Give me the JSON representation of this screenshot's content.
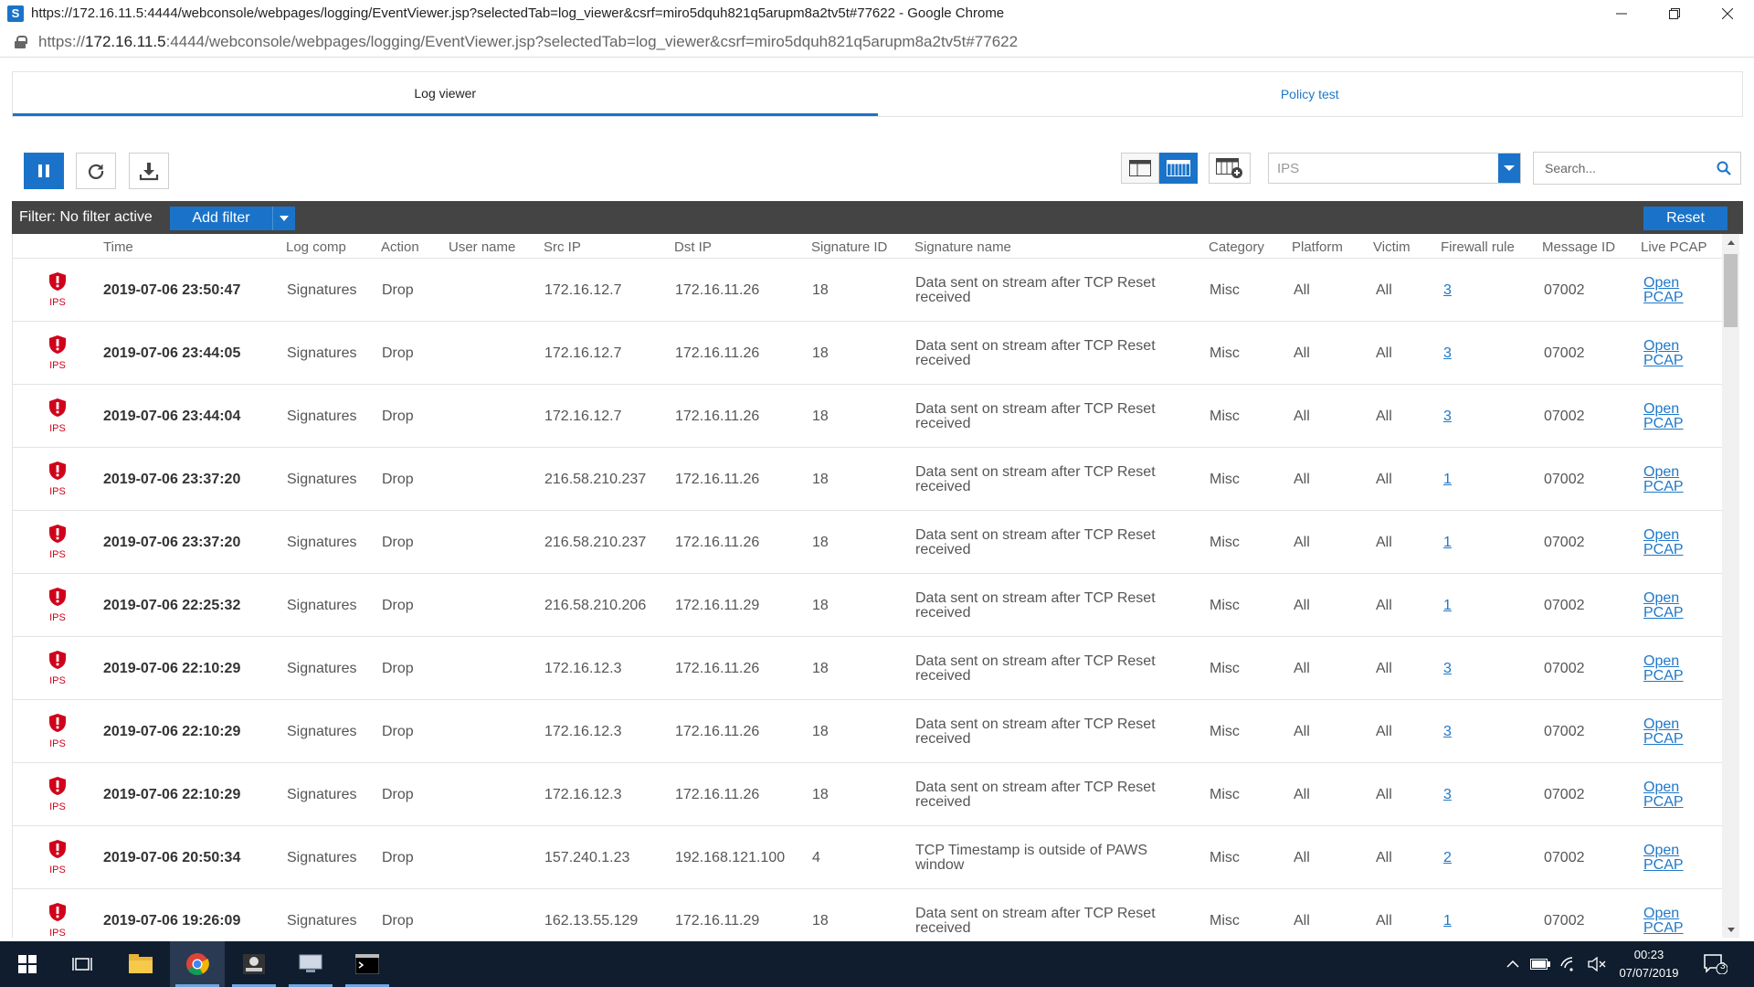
{
  "window": {
    "title": "https://172.16.11.5:4444/webconsole/webpages/logging/EventViewer.jsp?selectedTab=log_viewer&csrf=miro5dquh821q5arupm8a2tv5t#77622 - Google Chrome",
    "app_icon_letter": "S"
  },
  "address_bar": {
    "scheme": "https://",
    "host": "172.16.11.5",
    "rest": ":4444/webconsole/webpages/logging/EventViewer.jsp?selectedTab=log_viewer&csrf=miro5dquh821q5arupm8a2tv5t#77622"
  },
  "tabs": [
    {
      "label": "Log viewer",
      "active": true
    },
    {
      "label": "Policy test",
      "active": false
    }
  ],
  "toolbar": {
    "module_select_value": "IPS",
    "search_placeholder": "Search..."
  },
  "filter_bar": {
    "label": "Filter: No filter active",
    "add_filter_label": "Add filter",
    "reset_label": "Reset"
  },
  "table": {
    "columns": [
      "Time",
      "Log comp",
      "Action",
      "User name",
      "Src IP",
      "Dst IP",
      "Signature ID",
      "Signature name",
      "Category",
      "Platform",
      "Victim",
      "Firewall rule",
      "Message ID",
      "Live PCAP"
    ],
    "rows": [
      {
        "severity": "IPS",
        "time": "2019-07-06 23:50:47",
        "log_comp": "Signatures",
        "action": "Drop",
        "user": "",
        "src": "172.16.12.7",
        "dst": "172.16.11.26",
        "sig_id": "18",
        "sig_name": "Data sent on stream after TCP Reset received",
        "category": "Misc",
        "platform": "All",
        "victim": "All",
        "rule": "3",
        "msg_id": "07002",
        "pcap1": "Open",
        "pcap2": "PCAP"
      },
      {
        "severity": "IPS",
        "time": "2019-07-06 23:44:05",
        "log_comp": "Signatures",
        "action": "Drop",
        "user": "",
        "src": "172.16.12.7",
        "dst": "172.16.11.26",
        "sig_id": "18",
        "sig_name": "Data sent on stream after TCP Reset received",
        "category": "Misc",
        "platform": "All",
        "victim": "All",
        "rule": "3",
        "msg_id": "07002",
        "pcap1": "Open",
        "pcap2": "PCAP"
      },
      {
        "severity": "IPS",
        "time": "2019-07-06 23:44:04",
        "log_comp": "Signatures",
        "action": "Drop",
        "user": "",
        "src": "172.16.12.7",
        "dst": "172.16.11.26",
        "sig_id": "18",
        "sig_name": "Data sent on stream after TCP Reset received",
        "category": "Misc",
        "platform": "All",
        "victim": "All",
        "rule": "3",
        "msg_id": "07002",
        "pcap1": "Open",
        "pcap2": "PCAP"
      },
      {
        "severity": "IPS",
        "time": "2019-07-06 23:37:20",
        "log_comp": "Signatures",
        "action": "Drop",
        "user": "",
        "src": "216.58.210.237",
        "dst": "172.16.11.26",
        "sig_id": "18",
        "sig_name": "Data sent on stream after TCP Reset received",
        "category": "Misc",
        "platform": "All",
        "victim": "All",
        "rule": "1",
        "msg_id": "07002",
        "pcap1": "Open",
        "pcap2": "PCAP"
      },
      {
        "severity": "IPS",
        "time": "2019-07-06 23:37:20",
        "log_comp": "Signatures",
        "action": "Drop",
        "user": "",
        "src": "216.58.210.237",
        "dst": "172.16.11.26",
        "sig_id": "18",
        "sig_name": "Data sent on stream after TCP Reset received",
        "category": "Misc",
        "platform": "All",
        "victim": "All",
        "rule": "1",
        "msg_id": "07002",
        "pcap1": "Open",
        "pcap2": "PCAP"
      },
      {
        "severity": "IPS",
        "time": "2019-07-06 22:25:32",
        "log_comp": "Signatures",
        "action": "Drop",
        "user": "",
        "src": "216.58.210.206",
        "dst": "172.16.11.29",
        "sig_id": "18",
        "sig_name": "Data sent on stream after TCP Reset received",
        "category": "Misc",
        "platform": "All",
        "victim": "All",
        "rule": "1",
        "msg_id": "07002",
        "pcap1": "Open",
        "pcap2": "PCAP"
      },
      {
        "severity": "IPS",
        "time": "2019-07-06 22:10:29",
        "log_comp": "Signatures",
        "action": "Drop",
        "user": "",
        "src": "172.16.12.3",
        "dst": "172.16.11.26",
        "sig_id": "18",
        "sig_name": "Data sent on stream after TCP Reset received",
        "category": "Misc",
        "platform": "All",
        "victim": "All",
        "rule": "3",
        "msg_id": "07002",
        "pcap1": "Open",
        "pcap2": "PCAP"
      },
      {
        "severity": "IPS",
        "time": "2019-07-06 22:10:29",
        "log_comp": "Signatures",
        "action": "Drop",
        "user": "",
        "src": "172.16.12.3",
        "dst": "172.16.11.26",
        "sig_id": "18",
        "sig_name": "Data sent on stream after TCP Reset received",
        "category": "Misc",
        "platform": "All",
        "victim": "All",
        "rule": "3",
        "msg_id": "07002",
        "pcap1": "Open",
        "pcap2": "PCAP"
      },
      {
        "severity": "IPS",
        "time": "2019-07-06 22:10:29",
        "log_comp": "Signatures",
        "action": "Drop",
        "user": "",
        "src": "172.16.12.3",
        "dst": "172.16.11.26",
        "sig_id": "18",
        "sig_name": "Data sent on stream after TCP Reset received",
        "category": "Misc",
        "platform": "All",
        "victim": "All",
        "rule": "3",
        "msg_id": "07002",
        "pcap1": "Open",
        "pcap2": "PCAP"
      },
      {
        "severity": "IPS",
        "time": "2019-07-06 20:50:34",
        "log_comp": "Signatures",
        "action": "Drop",
        "user": "",
        "src": "157.240.1.23",
        "dst": "192.168.121.100",
        "sig_id": "4",
        "sig_name": "TCP Timestamp is outside of PAWS window",
        "category": "Misc",
        "platform": "All",
        "victim": "All",
        "rule": "2",
        "msg_id": "07002",
        "pcap1": "Open",
        "pcap2": "PCAP"
      },
      {
        "severity": "IPS",
        "time": "2019-07-06 19:26:09",
        "log_comp": "Signatures",
        "action": "Drop",
        "user": "",
        "src": "162.13.55.129",
        "dst": "172.16.11.29",
        "sig_id": "18",
        "sig_name": "Data sent on stream after TCP Reset received",
        "category": "Misc",
        "platform": "All",
        "victim": "All",
        "rule": "1",
        "msg_id": "07002",
        "pcap1": "Open",
        "pcap2": "PCAP"
      }
    ]
  },
  "taskbar": {
    "clock_time": "00:23",
    "clock_date": "07/07/2019",
    "notification_count": "3"
  },
  "colors": {
    "accent": "#1a73c8",
    "severity": "#d0021b",
    "filter_bar": "#444444",
    "taskbar": "#0f1d2e"
  }
}
